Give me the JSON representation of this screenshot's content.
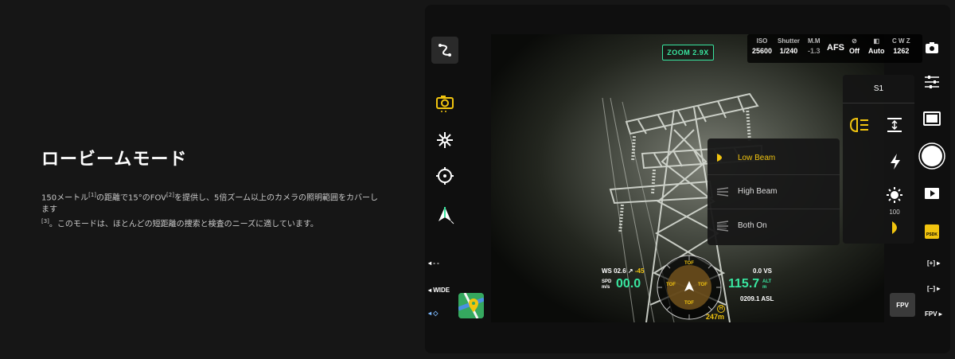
{
  "intro": {
    "title": "ロービームモード",
    "desc_1": "150メートル",
    "ref_1": "[1]",
    "desc_2": "の距離で15°のFOV",
    "ref_2": "[2]",
    "desc_3": "を提供し、5倍ズーム以上のカメラの照明範囲をカバーします",
    "ref_3": "[3]",
    "desc_4": "。このモードは、ほとんどの短距離の捜索と検査のニーズに適しています。"
  },
  "camera": {
    "zoom": "ZOOM 2.9X",
    "params": [
      {
        "label": "ISO",
        "value": "25600"
      },
      {
        "label": "Shutter",
        "value": "1/240"
      },
      {
        "label": "M.M",
        "value": "-1.3"
      },
      {
        "label": "",
        "value": "AFS"
      },
      {
        "label": "",
        "value": "Off"
      },
      {
        "label": "",
        "value": "Auto"
      },
      {
        "label": "C W Z",
        "value": "1262"
      }
    ]
  },
  "settings": {
    "slot": "S1",
    "brightness": "100",
    "beam_options": [
      {
        "label": "Low Beam",
        "selected": true
      },
      {
        "label": "High Beam",
        "selected": false
      },
      {
        "label": "Both On",
        "selected": false
      }
    ]
  },
  "left_bar": {
    "dash": "- -",
    "wide": "WIDE"
  },
  "right_bar": {
    "zoom_in": "[+]",
    "zoom_out": "[−]",
    "fpv": "FPV",
    "psdk": "PSDK"
  },
  "telemetry": {
    "ws": "WS 02.6",
    "ws_dir": "↗",
    "heading_offset": "-45",
    "spd_label": "SPD",
    "spd_unit": "m/s",
    "speed": "00.0",
    "vs": "0.0 VS",
    "alt": "115.7",
    "alt_label": "ALT",
    "alt_unit": "m",
    "asl": "0209.1 ASL",
    "dist": "247m",
    "tof": "TOF",
    "home": "H"
  },
  "colors": {
    "accent_yellow": "#f1c40f",
    "zoom_green": "#39e6a0",
    "speed_green": "#39e6a0"
  }
}
